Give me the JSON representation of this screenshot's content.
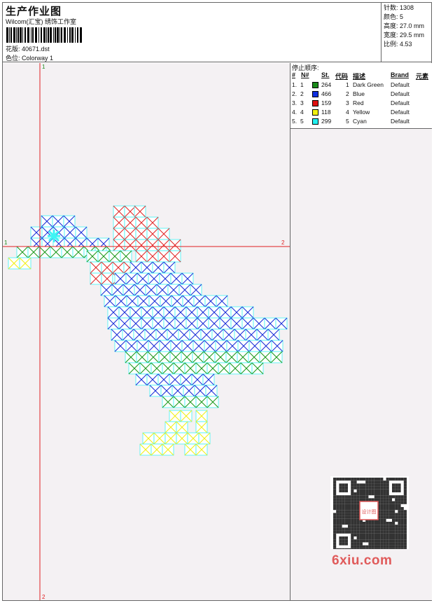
{
  "header": {
    "title": "生产作业图",
    "subtitle": "Wilcom(汇宝) 绣饰工作室",
    "design_label": "花版:",
    "design_file": "40671.dst",
    "colorway_label": "色位:",
    "colorway": "Colorway 1"
  },
  "stats": {
    "stitches": "针数: 1308",
    "colors": "颜色: 5",
    "height": "高度: 27.0 mm",
    "width": "宽度: 29.5 mm",
    "scale": "比例: 4.53"
  },
  "design": {
    "axis_h_left": "1",
    "axis_h_right": "2",
    "axis_v_top": "1",
    "axis_v_bottom": "2"
  },
  "legend": {
    "title": "停止顺序:",
    "columns": [
      "#",
      "N#",
      "St.",
      "代码",
      "描述",
      "Brand",
      "元素"
    ],
    "rows": [
      {
        "idx": "1.",
        "n": "1",
        "color": "#1a8a1a",
        "st": "264",
        "code": "1",
        "desc": "Dark Green",
        "brand": "Default"
      },
      {
        "idx": "2.",
        "n": "2",
        "color": "#1030e0",
        "st": "466",
        "code": "2",
        "desc": "Blue",
        "brand": "Default"
      },
      {
        "idx": "3.",
        "n": "3",
        "color": "#e01010",
        "st": "159",
        "code": "3",
        "desc": "Red",
        "brand": "Default"
      },
      {
        "idx": "4.",
        "n": "4",
        "color": "#f0f010",
        "st": "118",
        "code": "4",
        "desc": "Yellow",
        "brand": "Default"
      },
      {
        "idx": "5.",
        "n": "5",
        "color": "#20f0f0",
        "st": "299",
        "code": "5",
        "desc": "Cyan",
        "brand": "Default"
      }
    ]
  },
  "watermark": {
    "logo_text": "6xiu.com",
    "qr_center": "设计图"
  }
}
